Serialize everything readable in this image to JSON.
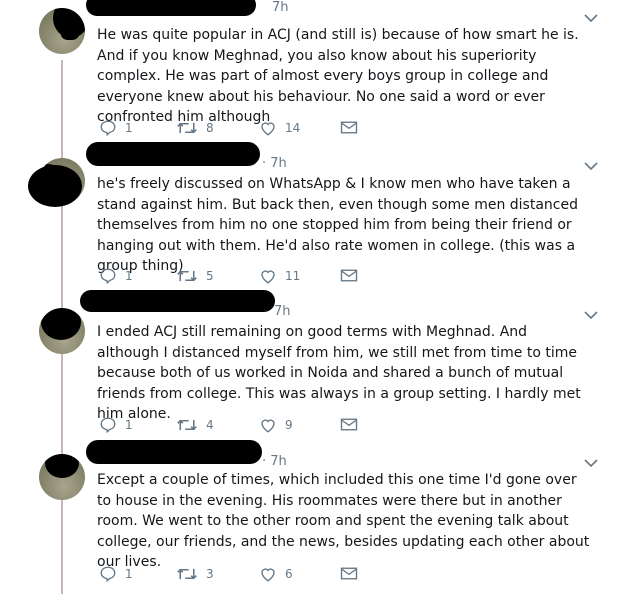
{
  "tweets": [
    {
      "time": "7h",
      "text": "He was quite popular in ACJ (and still is) because of how smart he is. And if you know Meghnad, you also know about his superiority complex. He was part of almost every boys group in college and everyone knew about his behaviour. No one said a word or ever confronted him although",
      "replies": "1",
      "retweets": "8",
      "likes": "14"
    },
    {
      "time": "· 7h",
      "text": "he's freely discussed on WhatsApp & I know men who have taken a stand against him. But back then, even though some men distanced themselves from him no one stopped him from being their friend or hanging out with them. He'd also rate women in college. (this was a group thing)",
      "replies": "1",
      "retweets": "5",
      "likes": "11"
    },
    {
      "time": "7h",
      "text": "I ended ACJ still remaining on good terms with Meghnad. And although I distanced myself from him, we still met from time to time because both of us worked in Noida and shared a bunch of mutual friends from college. This was always in a group setting. I hardly met him alone.",
      "replies": "1",
      "retweets": "4",
      "likes": "9"
    },
    {
      "time": "· 7h",
      "text": "Except a couple of times, which included this one time I'd gone over to house in the evening. His roommates were there but in another room. We went to the other room and spent the evening talk about college, our friends, and the news, besides updating each other about our lives.",
      "replies": "1",
      "retweets": "3",
      "likes": "6"
    }
  ],
  "icons": {
    "reply": "reply-icon",
    "retweet": "retweet-icon",
    "like": "heart-icon",
    "dm": "envelope-icon",
    "menu": "chevron-down-icon"
  },
  "colors": {
    "thread_line": "#c6b4bd",
    "meta": "#657786",
    "text": "#14171a"
  }
}
